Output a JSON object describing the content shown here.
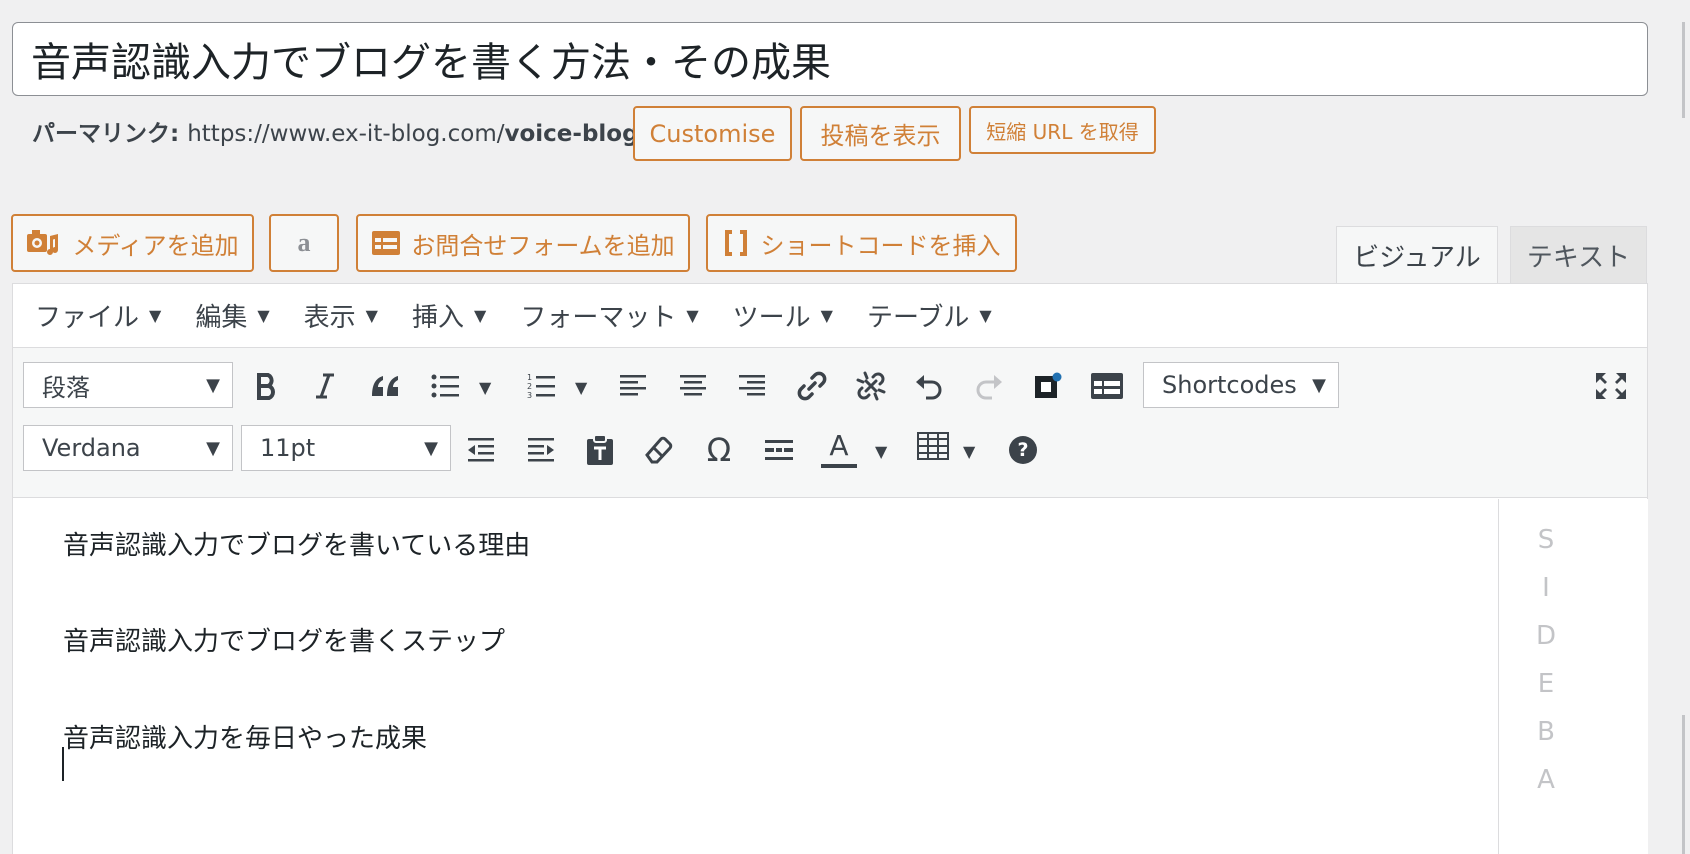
{
  "post": {
    "title": "音声認識入力でブログを書く方法・その成果"
  },
  "permalink": {
    "label": "パーマリンク:",
    "url_base": "https://www.ex-it-blog.com/",
    "slug": "voice-blog",
    "customise_label": "Customise",
    "view_post_label": "投稿を表示",
    "short_url_label": "短縮 URL を取得"
  },
  "media_buttons": {
    "add_media": "メディアを追加",
    "add_contact_form": "お問合せフォームを追加",
    "insert_shortcode": "ショートコードを挿入",
    "amazon_icon": "a"
  },
  "editor_tabs": {
    "visual": "ビジュアル",
    "text": "テキスト"
  },
  "menubar": {
    "items": [
      {
        "label": "ファイル"
      },
      {
        "label": "編集"
      },
      {
        "label": "表示"
      },
      {
        "label": "挿入"
      },
      {
        "label": "フォーマット"
      },
      {
        "label": "ツール"
      },
      {
        "label": "テーブル"
      }
    ]
  },
  "toolbar": {
    "format_select": "段落",
    "shortcodes_select": "Shortcodes",
    "font_family_select": "Verdana",
    "font_size_select": "11pt",
    "text_color_letter": "A",
    "special_char": "Ω",
    "help_symbol": "?"
  },
  "content": {
    "paragraphs": [
      "音声認識入力でブログを書いている理由",
      "音声認識入力でブログを書くステップ",
      "音声認識入力を毎日やった成果"
    ]
  },
  "sidebar": {
    "letters": [
      "S",
      "I",
      "D",
      "E",
      "B",
      "A"
    ]
  },
  "colors": {
    "accent": "#d08037",
    "icon": "#3c434a",
    "disabled": "#c3c4c7"
  }
}
